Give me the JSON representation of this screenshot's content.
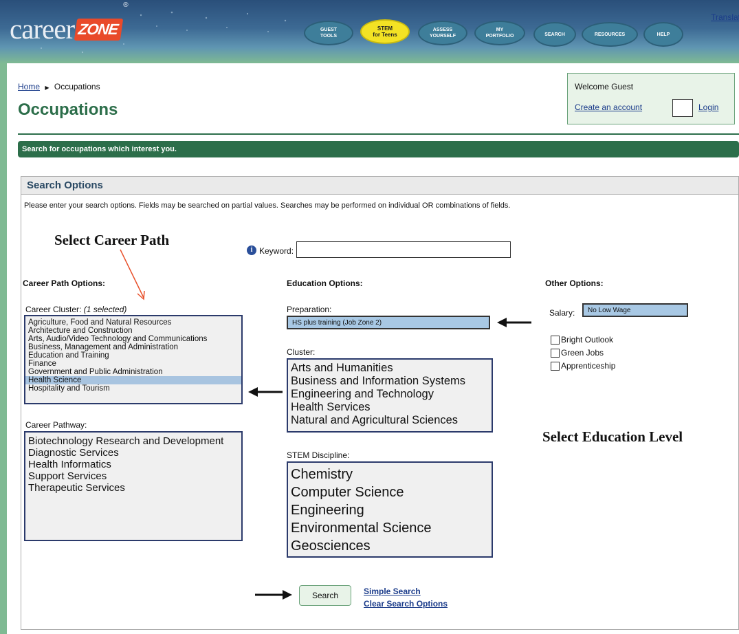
{
  "header": {
    "logo_text": "career",
    "logo_zone": "ZONE",
    "logo_reg": "®",
    "translate": "Translat",
    "nav": [
      {
        "line1": "GUEST",
        "line2": "TOOLS"
      },
      {
        "line1": "STEM",
        "line2": "for Teens"
      },
      {
        "line1": "ASSESS",
        "line2": "YOURSELF"
      },
      {
        "line1": "MY",
        "line2": "PORTFOLIO"
      },
      {
        "line1": "SEARCH",
        "line2": ""
      },
      {
        "line1": "RESOURCES",
        "line2": ""
      },
      {
        "line1": "HELP",
        "line2": ""
      }
    ]
  },
  "breadcrumb": {
    "home": "Home",
    "sep": "▶",
    "current": "Occupations"
  },
  "page_title": "Occupations",
  "welcome": {
    "text": "Welcome Guest",
    "create": "Create an account",
    "login": "Login"
  },
  "banner": "Search for occupations which interest you.",
  "search_options": {
    "heading": "Search Options",
    "instructions": "Please enter your search options. Fields may be searched on partial values. Searches may be performed on individual OR combinations of fields.",
    "keyword_label": "Keyword:",
    "info_icon": "i"
  },
  "annotations": {
    "career_path": "Select Career Path",
    "education": "Select Education Level"
  },
  "career_path": {
    "heading": "Career Path Options:",
    "cluster_label": "Career Cluster:",
    "cluster_selected": "(1 selected)",
    "clusters": [
      "Agriculture, Food and Natural Resources",
      "Architecture and Construction",
      "Arts, Audio/Video Technology and Communications",
      "Business, Management and Administration",
      "Education and Training",
      "Finance",
      "Government and Public Administration",
      "Health Science",
      "Hospitality and Tourism"
    ],
    "selected_cluster": "Health Science",
    "pathway_label": "Career Pathway:",
    "pathways": [
      "Biotechnology Research and Development",
      "Diagnostic Services",
      "Health Informatics",
      "Support Services",
      "Therapeutic Services"
    ]
  },
  "education": {
    "heading": "Education Options:",
    "preparation_label": "Preparation:",
    "preparation_value": "HS plus training (Job Zone 2)",
    "cluster_label": "Cluster:",
    "clusters": [
      "Arts and Humanities",
      "Business and Information Systems",
      "Engineering and Technology",
      "Health Services",
      "Natural and Agricultural Sciences"
    ],
    "stem_label": "STEM Discipline:",
    "stem": [
      "Chemistry",
      "Computer Science",
      "Engineering",
      "Environmental Science",
      "Geosciences"
    ]
  },
  "other": {
    "heading": "Other Options:",
    "salary_label": "Salary:",
    "salary_value": "No Low Wage",
    "checkboxes": [
      "Bright Outlook",
      "Green Jobs",
      "Apprenticeship"
    ]
  },
  "actions": {
    "search": "Search",
    "simple_search": "Simple Search",
    "clear": "Clear Search Options"
  },
  "colors": {
    "brand_green": "#2c6e4a",
    "selection_blue": "#a8c4e0",
    "annotation_arrow": "#e8502a"
  }
}
